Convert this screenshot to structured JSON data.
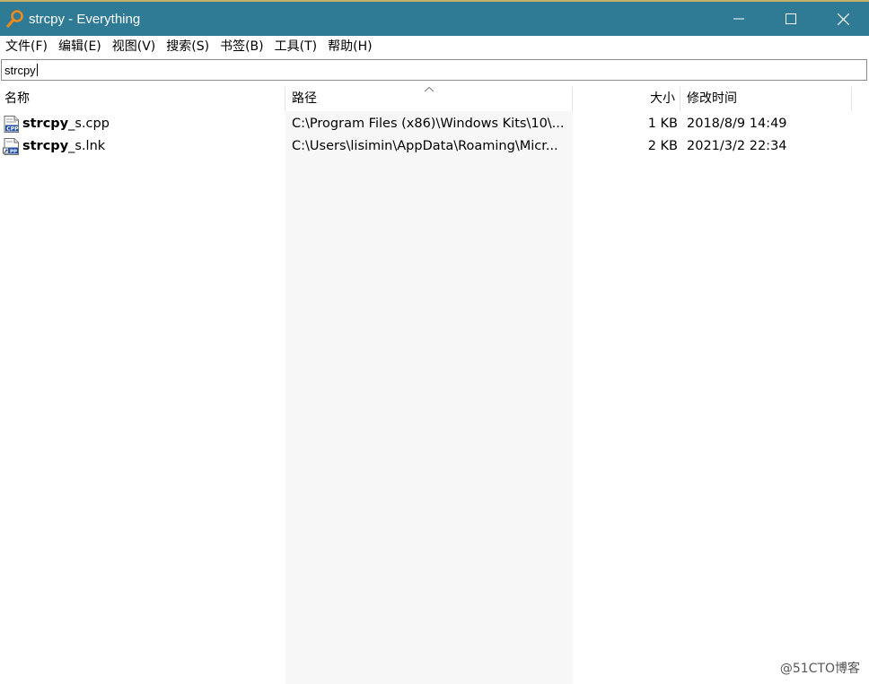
{
  "window": {
    "title": "strcpy - Everything",
    "titlebar_color": "#2f7b96",
    "app_icon": "magnifier-icon"
  },
  "menu": {
    "items": [
      "文件(F)",
      "编辑(E)",
      "视图(V)",
      "搜索(S)",
      "书签(B)",
      "工具(T)",
      "帮助(H)"
    ]
  },
  "search": {
    "value": "strcpy"
  },
  "columns": {
    "name": "名称",
    "path": "路径",
    "size": "大小",
    "modified": "修改时间"
  },
  "results": [
    {
      "name_bold": "strcpy",
      "name_rest": "_s.cpp",
      "icon": "cpp-file-icon",
      "path": "C:\\Program Files (x86)\\Windows Kits\\10\\...",
      "size": "1 KB",
      "modified": "2018/8/9 14:49"
    },
    {
      "name_bold": "strcpy",
      "name_rest": "_s.lnk",
      "icon": "shortcut-file-icon",
      "path": "C:\\Users\\lisimin\\AppData\\Roaming\\Micr...",
      "size": "2 KB",
      "modified": "2021/3/2 22:34"
    }
  ],
  "watermark": "@51CTO博客"
}
